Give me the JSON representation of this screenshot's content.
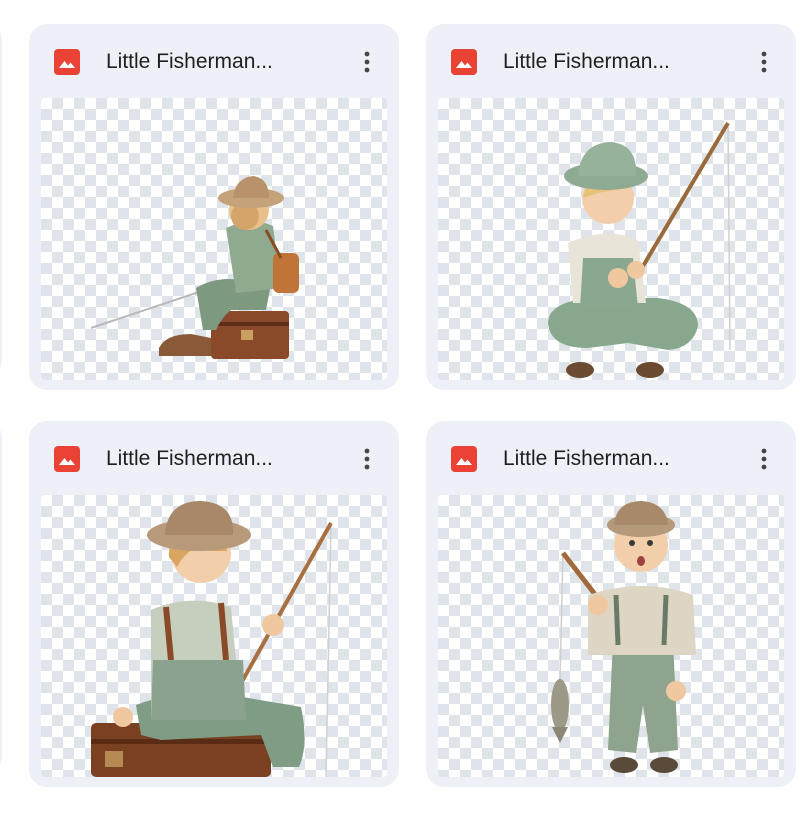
{
  "files": [
    {
      "title": "Little Fisherman...",
      "type": "image",
      "icon": "image-file-icon",
      "icon_color": "#ea4335",
      "preview": "boy sitting on trunk with fishing rod, seen from behind"
    },
    {
      "title": "Little Fisherman...",
      "type": "image",
      "icon": "image-file-icon",
      "icon_color": "#ea4335",
      "preview": "boy in green hat sitting holding fishing rod"
    },
    {
      "title": "Little Fisherman...",
      "type": "image",
      "icon": "image-file-icon",
      "icon_color": "#ea4335",
      "preview": "boy with straw hat sitting on trunk holding rod"
    },
    {
      "title": "Little Fisherman...",
      "type": "image",
      "icon": "image-file-icon",
      "icon_color": "#ea4335",
      "preview": "surprised boy standing holding rod with caught fish"
    }
  ],
  "colors": {
    "card_bg": "#edf1f7",
    "checker": "#dfe3ea",
    "title_text": "#1f1f1f",
    "menu_dots": "#444746"
  }
}
